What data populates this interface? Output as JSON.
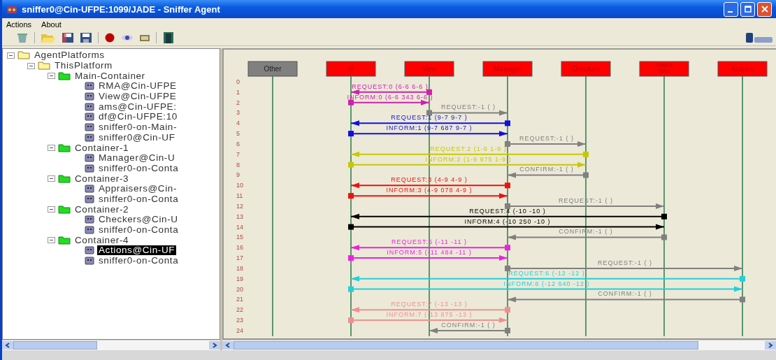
{
  "window": {
    "title": "sniffer0@Cin-UFPE:1099/JADE - Sniffer Agent"
  },
  "menu": [
    "Actions",
    "About"
  ],
  "tree": [
    {
      "label": "AgentPlatforms",
      "kind": "folder",
      "expanded": true,
      "children": [
        {
          "label": "ThisPlatform",
          "kind": "folder",
          "expanded": true,
          "children": [
            {
              "label": "Main-Container",
              "kind": "container",
              "expanded": true,
              "children": [
                {
                  "label": "RMA@Cin-UFPE",
                  "kind": "agent",
                  "selected": false
                },
                {
                  "label": "View@Cin-UFPE",
                  "kind": "agent",
                  "selected": false
                },
                {
                  "label": "ams@Cin-UFPE:",
                  "kind": "agent",
                  "selected": false
                },
                {
                  "label": "df@Cin-UFPE:10",
                  "kind": "agent",
                  "selected": false
                },
                {
                  "label": "sniffer0-on-Main-",
                  "kind": "agent",
                  "selected": false
                },
                {
                  "label": "sniffer0@Cin-UF",
                  "kind": "agent",
                  "selected": false
                }
              ]
            },
            {
              "label": "Container-1",
              "kind": "container",
              "expanded": true,
              "children": [
                {
                  "label": "Manager@Cin-U",
                  "kind": "agent",
                  "selected": false
                },
                {
                  "label": "sniffer0-on-Conta",
                  "kind": "agent",
                  "selected": false
                }
              ]
            },
            {
              "label": "Container-3",
              "kind": "container",
              "expanded": true,
              "children": [
                {
                  "label": "Appraisers@Cin-",
                  "kind": "agent",
                  "selected": false
                },
                {
                  "label": "sniffer0-on-Conta",
                  "kind": "agent",
                  "selected": false
                }
              ]
            },
            {
              "label": "Container-2",
              "kind": "container",
              "expanded": true,
              "children": [
                {
                  "label": "Checkers@Cin-U",
                  "kind": "agent",
                  "selected": false
                },
                {
                  "label": "sniffer0-on-Conta",
                  "kind": "agent",
                  "selected": false
                }
              ]
            },
            {
              "label": "Container-4",
              "kind": "container",
              "expanded": true,
              "children": [
                {
                  "label": "Actions@Cin-UF",
                  "kind": "agent",
                  "selected": true
                },
                {
                  "label": "sniffer0-on-Conta",
                  "kind": "agent",
                  "selected": false
                }
              ]
            }
          ]
        }
      ]
    }
  ],
  "agents": [
    {
      "lines": [
        "Other"
      ],
      "color": "#808080"
    },
    {
      "lines": [
        "df"
      ],
      "color": "#ff0000"
    },
    {
      "lines": [
        "View"
      ],
      "color": "#ff0000"
    },
    {
      "lines": [
        "Manager"
      ],
      "color": "#ff0000"
    },
    {
      "lines": [
        "Checkers"
      ],
      "color": "#ff0000"
    },
    {
      "lines": [
        "Appra",
        "isers"
      ],
      "color": "#ff0000"
    },
    {
      "lines": [
        "Actions"
      ],
      "color": "#ff0000"
    }
  ],
  "row_numbers": [
    "0",
    "1",
    "2",
    "3",
    "4",
    "5",
    "6",
    "7",
    "8",
    "9",
    "10",
    "11",
    "12",
    "13",
    "14",
    "15",
    "16",
    "17",
    "18",
    "19",
    "20",
    "21",
    "22",
    "23",
    "24"
  ],
  "messages": [
    {
      "label": "REQUEST:0 (6-6 6-6 )",
      "color": "#cc22aa"
    },
    {
      "label": "INFORM:0 (6-6 343 6-6 )",
      "color": "#cc22aa"
    },
    {
      "label": "REQUEST:-1 ( )",
      "color": "#808080"
    },
    {
      "label": "REQUEST:1 (9-7 9-7 )",
      "color": "#1010e0"
    },
    {
      "label": "INFORM:1 (9-7 687 9-7 )",
      "color": "#1010e0"
    },
    {
      "label": "REQUEST:-1 ( )",
      "color": "#808080"
    },
    {
      "label": "REQUEST:2 (1-9 1-9 )",
      "color": "#c8c800"
    },
    {
      "label": "INFORM:2 (1-9 975 1-9 )",
      "color": "#c8c800"
    },
    {
      "label": "CONFIRM:-1 ( )",
      "color": "#808080"
    },
    {
      "label": "REQUEST:3 (4-9 4-9 )",
      "color": "#ee1111"
    },
    {
      "label": "INFORM:3 (4-9 078 4-9 )",
      "color": "#ee1111"
    },
    {
      "label": "REQUEST:-1 ( )",
      "color": "#808080"
    },
    {
      "label": "REQUEST:4 (-10 -10 )",
      "color": "#000000"
    },
    {
      "label": "INFORM:4 (-10 250 -10 )",
      "color": "#000000"
    },
    {
      "label": "CONFIRM:-1 ( )",
      "color": "#808080"
    },
    {
      "label": "REQUEST:5 (-11 -11 )",
      "color": "#ee22dd"
    },
    {
      "label": "INFORM:5 (-11 484 -11 )",
      "color": "#ee22dd"
    },
    {
      "label": "REQUEST:-1 ( )",
      "color": "#808080"
    },
    {
      "label": "REQUEST:6 (-12 -12 )",
      "color": "#22d0d8"
    },
    {
      "label": "INFORM:6 (-12 640 -12 )",
      "color": "#22d0d8"
    },
    {
      "label": "CONFIRM:-1 ( )",
      "color": "#808080"
    },
    {
      "label": "REQUEST:7 (-13 -13 )",
      "color": "#f09090"
    },
    {
      "label": "INFORM:7 (-13 875 -13 )",
      "color": "#f09090"
    },
    {
      "label": "CONFIRM:-1 ( )",
      "color": "#808080"
    }
  ]
}
